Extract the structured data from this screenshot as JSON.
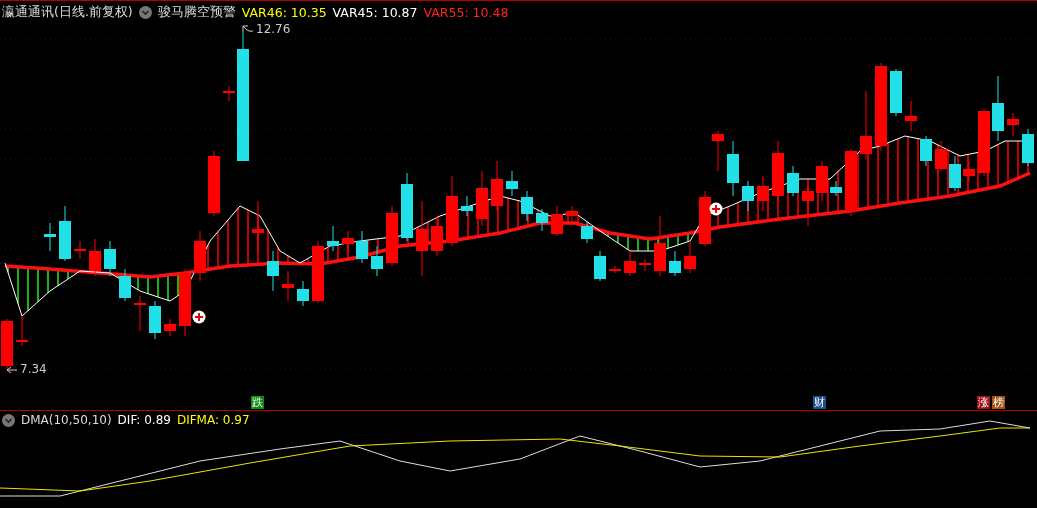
{
  "header": {
    "stock": "瀛通通讯(日线.前复权)",
    "indicator": "骏马腾空预警",
    "values": [
      {
        "label": "VAR46: 10.35",
        "color": "#ffff00"
      },
      {
        "label": "VAR45: 10.87",
        "color": "#ffffff"
      },
      {
        "label": "VAR55: 10.48",
        "color": "#ff2020"
      }
    ]
  },
  "price_labels": [
    {
      "kind": "high",
      "text": "12.76"
    },
    {
      "kind": "low",
      "text": "7.34"
    }
  ],
  "events": [
    {
      "text": "跌",
      "color": "#118a11"
    },
    {
      "text": "财",
      "color": "#1d4f8f"
    },
    {
      "text": "涨",
      "color": "#9c1313"
    },
    {
      "text": "榜",
      "color": "#a35211"
    }
  ],
  "indicator_panel": {
    "title": "DMA(10,50,10)",
    "values": [
      {
        "label": "DIF: 0.89",
        "color": "#ffffff"
      },
      {
        "label": "DIFMA: 0.97",
        "color": "#ffff00"
      }
    ]
  }
}
